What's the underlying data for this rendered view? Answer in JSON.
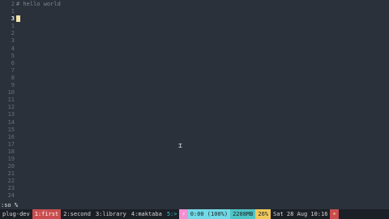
{
  "editor": {
    "gutter": [
      "2",
      "1",
      "3",
      "1",
      "2",
      "3",
      "4",
      "5",
      "6",
      "7",
      "8",
      "9",
      "10",
      "11",
      "12",
      "13",
      "14",
      "15",
      "16",
      "17",
      "18",
      "19",
      "20",
      "21",
      "22",
      "23",
      "24"
    ],
    "lines": [
      "# hello world",
      "",
      "",
      "",
      "",
      "",
      "",
      "",
      "",
      "",
      "",
      "",
      "",
      "",
      "",
      "",
      "",
      "",
      "",
      "",
      "",
      "",
      "",
      "",
      "",
      "",
      ""
    ],
    "current_line_index": 2
  },
  "cmdline": ":so %",
  "tmux": {
    "session": "plug-dev",
    "windows": [
      {
        "label": "1:first",
        "active": true
      },
      {
        "label": "2:second",
        "active": false
      },
      {
        "label": "3:library",
        "active": false
      },
      {
        "label": "4:maktaba",
        "active": false
      },
      {
        "label": "5:>",
        "active": false
      }
    ],
    "battery_icon": "⚡",
    "uptime": "0:00 (100%)",
    "memory": "2208MB",
    "percent": "26%",
    "datetime": "Sat 28 Aug 10:16",
    "sun_icon": "☀"
  },
  "colors": {
    "background": "#2a313b",
    "cursor": "#f3e3a7",
    "active_window": "#c94d4f"
  }
}
